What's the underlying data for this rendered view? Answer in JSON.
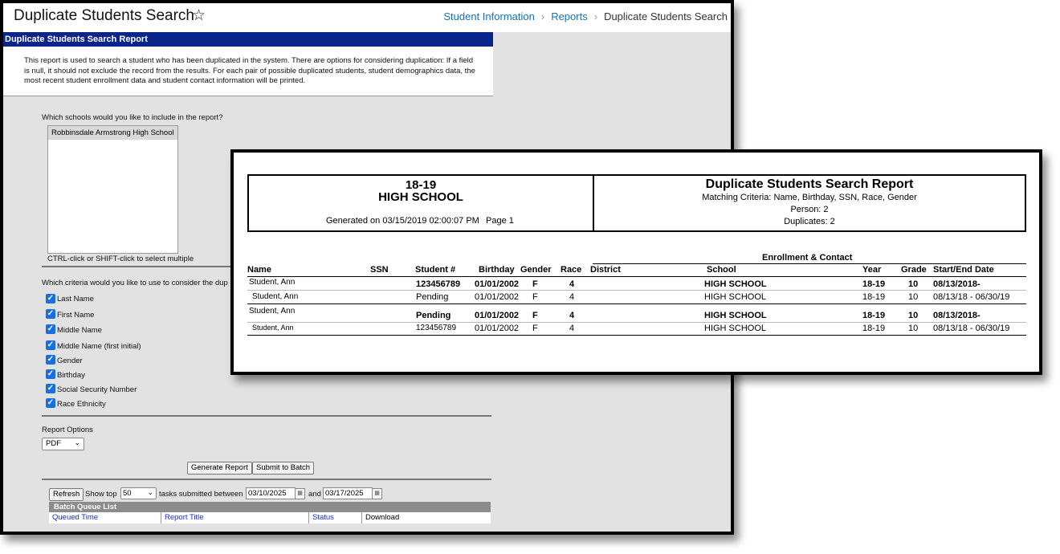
{
  "window": {
    "title": "Duplicate Students Search",
    "breadcrumb": [
      "Student Information",
      "Reports",
      "Duplicate Students Search"
    ]
  },
  "form": {
    "header": "Duplicate Students Search Report",
    "description": "This report is used to search a student who has been duplicated in the system. There are options for considering duplication: If a field is null, it should not exclude the record from the results. For each pair of possible duplicated students, student demographics data, the most recent student enrollment data and student contact information will be printed.",
    "schools_question": "Which schools would you like to include in the report?",
    "schools": [
      "Robbinsdale Armstrong High School"
    ],
    "multi_select_hint": "CTRL-click or SHIFT-click to select multiple",
    "criteria_question": "Which criteria would you like to use to consider the dup",
    "criteria": [
      {
        "label": "Last Name",
        "checked": true
      },
      {
        "label": "First Name",
        "checked": true
      },
      {
        "label": "Middle Name",
        "checked": true
      },
      {
        "label": "Middle Name (first initial)",
        "checked": true
      },
      {
        "label": "Gender",
        "checked": true
      },
      {
        "label": "Birthday",
        "checked": true
      },
      {
        "label": "Social Security Number",
        "checked": true
      },
      {
        "label": "Race Ethnicity",
        "checked": true
      }
    ],
    "report_options_label": "Report Options",
    "format_selected": "PDF",
    "generate_label": "Generate Report",
    "batch_label": "Submit to Batch"
  },
  "batch": {
    "refresh_label": "Refresh",
    "show_top_label": "Show top",
    "show_top_value": "50",
    "between_label": "tasks submitted between",
    "start_date": "03/10/2025",
    "and_label": "and",
    "end_date": "03/17/2025",
    "queue_title": "Batch Queue List",
    "columns": [
      "Queued Time",
      "Report Title",
      "Status",
      "Download"
    ]
  },
  "report": {
    "year": "18-19",
    "school": "HIGH SCHOOL",
    "generated": "Generated on 03/15/2019 02:00:07 PM",
    "page": "Page 1",
    "title": "Duplicate Students Search Report",
    "criteria": "Matching Criteria: Name, Birthday, SSN, Race, Gender",
    "person": "Person: 2",
    "duplicates": "Duplicates: 2",
    "enrollment_header": "Enrollment & Contact",
    "columns": {
      "name": "Name",
      "ssn": "SSN",
      "student_num": "Student #",
      "birthday": "Birthday",
      "gender": "Gender",
      "race": "Race",
      "district": "District",
      "school": "School",
      "year": "Year",
      "grade": "Grade",
      "dates": "Start/End Date"
    },
    "rows": [
      {
        "name": "Student, Ann",
        "student_num": "123456789",
        "birthday": "01/01/2002",
        "gender": "F",
        "race": "4",
        "school": "HIGH SCHOOL",
        "year": "18-19",
        "grade": "10",
        "dates": "08/13/2018-"
      },
      {
        "name": "Student, Ann",
        "student_num": "Pending",
        "birthday": "01/01/2002",
        "gender": "F",
        "race": "4",
        "school": "HIGH SCHOOL",
        "year": "18-19",
        "grade": "10",
        "dates": "08/13/18 - 06/30/19"
      },
      {
        "name": "Student, Ann",
        "student_num": "Pending",
        "birthday": "01/01/2002",
        "gender": "F",
        "race": "4",
        "school": "HIGH SCHOOL",
        "year": "18-19",
        "grade": "10",
        "dates": "08/13/2018-"
      },
      {
        "name": "Student, Ann",
        "student_num": "123456789",
        "birthday": "01/01/2002",
        "gender": "F",
        "race": "4",
        "school": "HIGH SCHOOL",
        "year": "18-19",
        "grade": "10",
        "dates": "08/13/18 - 06/30/19"
      }
    ]
  }
}
